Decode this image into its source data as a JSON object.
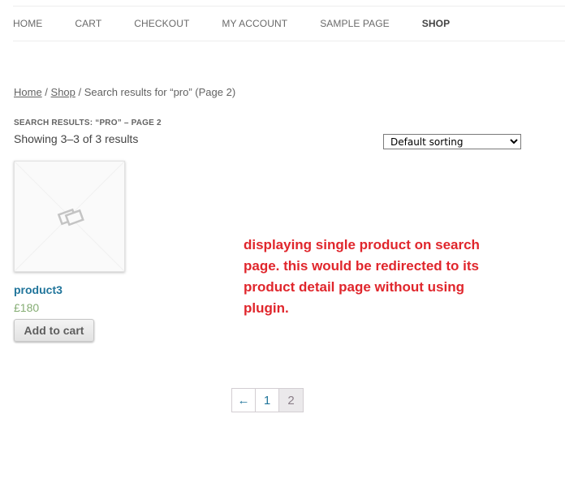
{
  "nav": {
    "items": [
      {
        "label": "Home"
      },
      {
        "label": "Cart"
      },
      {
        "label": "Checkout"
      },
      {
        "label": "My Account"
      },
      {
        "label": "Sample Page"
      },
      {
        "label": "Shop"
      }
    ],
    "active": "Shop"
  },
  "breadcrumb": {
    "home": "Home",
    "sep1": " / ",
    "shop": "Shop",
    "sep2": " / ",
    "current": "Search results for “pro” (Page 2)"
  },
  "results": {
    "title": "Search Results: “pro” – Page 2",
    "count_text": "Showing 3–3 of 3 results"
  },
  "sorting": {
    "selected": "Default sorting"
  },
  "product": {
    "name": "product3",
    "price": "£180",
    "add_to_cart_label": "Add to cart",
    "image_icon": "placeholder-image-icon"
  },
  "annotation": {
    "text": "displaying single product on search page. this would be redirected to its product detail page without using plugin.",
    "color": "#e0262c"
  },
  "pagination": {
    "prev": "←",
    "pages": [
      "1",
      "2"
    ],
    "current": "2"
  },
  "colors": {
    "link": "#21759b",
    "price": "#85ad74",
    "annotation": "#e0262c"
  }
}
